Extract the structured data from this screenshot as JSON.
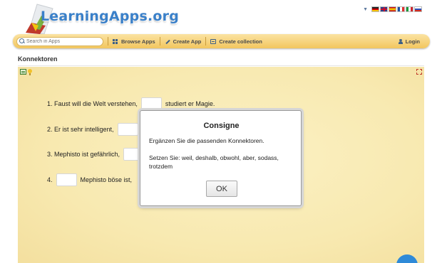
{
  "header": {
    "logo_text": "LearningApps.org",
    "languages": [
      {
        "code": "de",
        "colors": [
          "#222222",
          "#d40000",
          "#f5c400"
        ]
      },
      {
        "code": "en",
        "colors": [
          "#2a3f8c",
          "#ffffff",
          "#c8102e"
        ]
      },
      {
        "code": "es",
        "colors": [
          "#c60b1e",
          "#f1bf00",
          "#c60b1e"
        ]
      },
      {
        "code": "fr",
        "colors": [
          "#1d4fa0",
          "#ffffff",
          "#e03030"
        ]
      },
      {
        "code": "it",
        "colors": [
          "#1a9b3b",
          "#ffffff",
          "#d0252d"
        ]
      },
      {
        "code": "ru",
        "colors": [
          "#ffffff",
          "#2a52be",
          "#d52b1e"
        ]
      }
    ]
  },
  "nav": {
    "search_placeholder": "Search in Apps",
    "browse_label": "Browse Apps",
    "create_label": "Create App",
    "collection_label": "Create collection",
    "login_label": "Login"
  },
  "page": {
    "title": "Konnektoren"
  },
  "exercise": {
    "s1": {
      "before": "1. Faust will die Welt verstehen,",
      "after": "studiert er Magie."
    },
    "s2": {
      "before": "2. Er ist sehr intelligent,"
    },
    "s3": {
      "before": "3. Mephisto ist gefährlich,"
    },
    "s4": {
      "before": "4.",
      "after": "Mephisto böse ist,"
    }
  },
  "dialog": {
    "title": "Consigne",
    "line1": "Ergänzen Sie die passenden Konnektoren.",
    "line2": "Setzen Sie: weil, deshalb, obwohl, aber, sodass, trotzdem",
    "ok_label": "OK"
  },
  "colors": {
    "accent": "#3a80c9",
    "navbar": "#f2c65e",
    "app_background": "#f8e9b0"
  }
}
